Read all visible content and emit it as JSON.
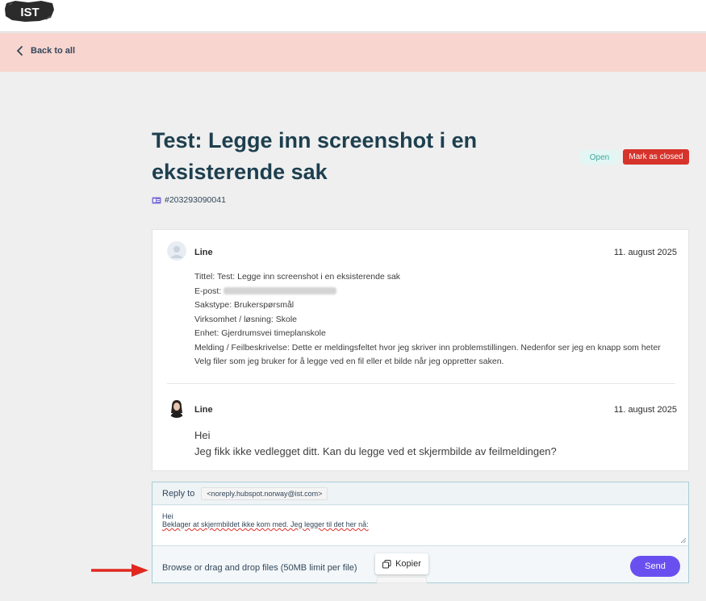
{
  "header": {
    "logo_text": "IST"
  },
  "nav": {
    "back_label": "Back to all"
  },
  "ticket": {
    "title": "Test: Legge inn screenshot i en eksisterende sak",
    "id": "#203293090041",
    "status": "Open",
    "mark_closed_label": "Mark as closed"
  },
  "messages": [
    {
      "author": "Line",
      "date": "11. august 2025",
      "lines": {
        "title": "Tittel: Test: Legge inn screenshot i en eksisterende sak",
        "email_label": "E-post:",
        "case_type": "Sakstype: Brukerspørsmål",
        "business": "Virksomhet / løsning: Skole",
        "unit": "Enhet: Gjerdrumsvei timeplanskole",
        "message": "Melding / Feilbeskrivelse: Dette er meldingsfeltet hvor jeg skriver inn problemstillingen. Nedenfor ser jeg en knapp som heter Velg filer som jeg bruker for å legge ved en fil eller et bilde når jeg oppretter saken."
      }
    },
    {
      "author": "Line",
      "date": "11. august 2025",
      "body_line1": "Hei",
      "body_line2": "Jeg fikk ikke vedlegget ditt. Kan du legge ved et skjermbilde av feilmeldingen?"
    }
  ],
  "reply": {
    "to_label": "Reply to",
    "to_email": "<noreply.hubspot.norway@ist.com>",
    "text_line1": "Hei",
    "text_line2": "Beklager at skjermbildet ikke kom med. Jeg legger til det her nå:",
    "browse_label": "Browse or drag and drop files  (50MB limit per file)",
    "copy_label": "Kopier",
    "send_label": "Send"
  },
  "colors": {
    "back_bar": "#f8d5cf",
    "open_badge_bg": "#e3f6f3",
    "mark_closed_bg": "#d6332b",
    "send_bg": "#6a4ff0",
    "arrow": "#e0281f"
  }
}
